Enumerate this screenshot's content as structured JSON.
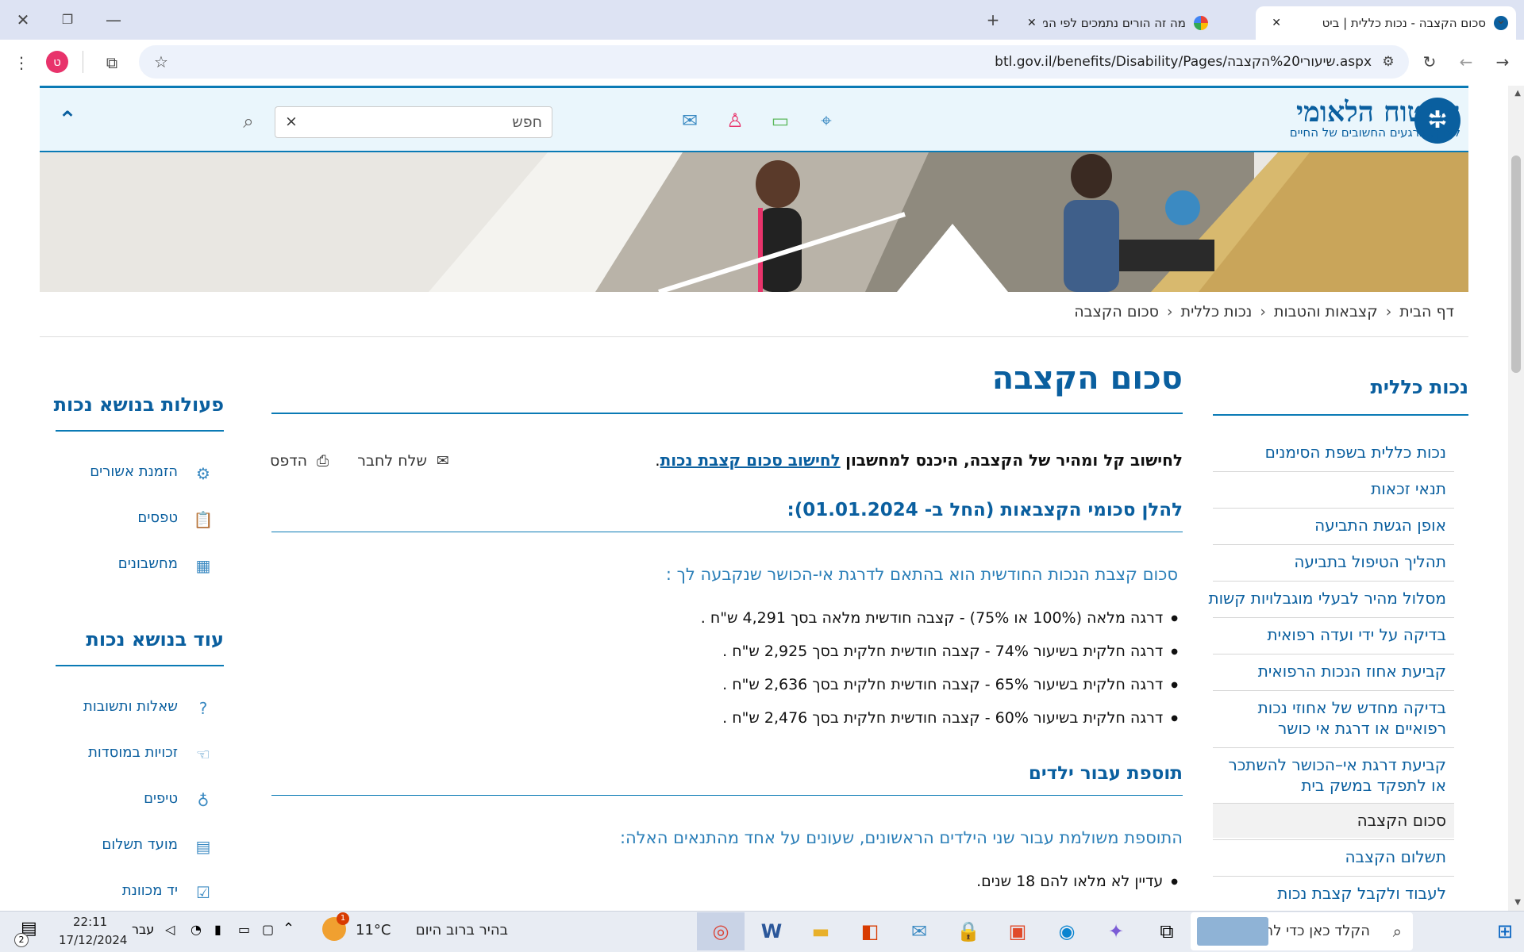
{
  "browser": {
    "tabs": [
      {
        "label": "סכום הקצבה - נכות כללית | ביט"
      },
      {
        "label": "מה זה הורים נתמכים לפי המלל"
      }
    ],
    "url": "btl.gov.il/benefits/Disability/Pages/שיעורי%20הקצבה.aspx",
    "profile_initial": "ט"
  },
  "header": {
    "logo_title": "הביטוח הלאומי",
    "logo_subtitle": "לצדך, ברגעים החשובים של החיים",
    "search_placeholder": "חפש",
    "search_clear": "×"
  },
  "breadcrumb": [
    "דף הבית",
    "קצבאות והטבות",
    "נכות כללית",
    "סכום הקצבה"
  ],
  "right_nav": {
    "title": "נכות כללית",
    "items": [
      "נכות כללית בשפת הסימנים",
      "תנאי זכאות",
      "אופן הגשת התביעה",
      "תהליך הטיפול בתביעה",
      "מסלול מהיר לבעלי מוגבלויות קשות",
      "בדיקה על ידי ועדה רפואית",
      "קביעת אחוז הנכות הרפואית",
      "בדיקה מחדש של אחוזי נכות",
      "רפואיים או דרגת אי כושר",
      "קביעת דרגת אי–הכושר להשתכר",
      "או לתפקד במשק בית",
      "סכום הקצבה",
      "תשלום הקצבה",
      "לעבוד ולקבל קצבת נכות"
    ]
  },
  "main": {
    "title": "סכום הקצבה",
    "intro_bold": "לחישוב קל ומהיר של הקצבה, היכנס למחשבון",
    "intro_link": "לחישוב סכום קצבת נכות",
    "intro_end": ".",
    "send_friend": "שלח לחבר",
    "print": "הדפס",
    "section1_title": "להלן סכומי הקצבאות (החל ב- 01.01.2024):",
    "section1_sub": "סכום קצבת הנכות החודשית הוא בהתאם לדרגת אי-הכושר שנקבעה לך :",
    "bullets": [
      "דרגה מלאה (100% או 75%) - קצבה חודשית מלאה בסך 4,291 ש\"ח .",
      "דרגה חלקית בשיעור 74% - קצבה חודשית חלקית בסך 2,925 ש\"ח .",
      "דרגה חלקית בשיעור 65% - קצבה חודשית חלקית בסך 2,636 ש\"ח .",
      "דרגה חלקית בשיעור 60% - קצבה חודשית חלקית בסך 2,476 ש\"ח ."
    ],
    "section2_title": "תוספת עבור ילדים",
    "section2_sub": "התוספת משולמת עבור שני הילדים הראשונים, שעונים על אחד מהתנאים האלה:",
    "section2_bullet": "עדיין לא מלאו להם 18 שנים."
  },
  "left_side": {
    "actions_title": "פעולות בנושא נכות",
    "actions": [
      {
        "label": "הזמנת אשורים",
        "icon": "gear-icon"
      },
      {
        "label": "טפסים",
        "icon": "clipboard-icon"
      },
      {
        "label": "מחשבונים",
        "icon": "calculator-icon"
      }
    ],
    "more_title": "עוד בנושא נכות",
    "more": [
      {
        "label": "שאלות ותשובות",
        "icon": "question-icon"
      },
      {
        "label": "זכויות במוסדות",
        "icon": "hand-icon"
      },
      {
        "label": "טיפים",
        "icon": "lightbulb-icon"
      },
      {
        "label": "מועד תשלום",
        "icon": "calendar-icon"
      },
      {
        "label": "יד מכוונת",
        "icon": "checklist-icon"
      }
    ]
  },
  "taskbar": {
    "search_placeholder": "הקלד כאן כדי לחפש",
    "weather_text": "בהיר ברוב היום",
    "temperature": "11°C",
    "language": "עבר",
    "time": "22:11",
    "date": "17/12/2024",
    "notification_count": "2",
    "weather_badge": "1"
  }
}
